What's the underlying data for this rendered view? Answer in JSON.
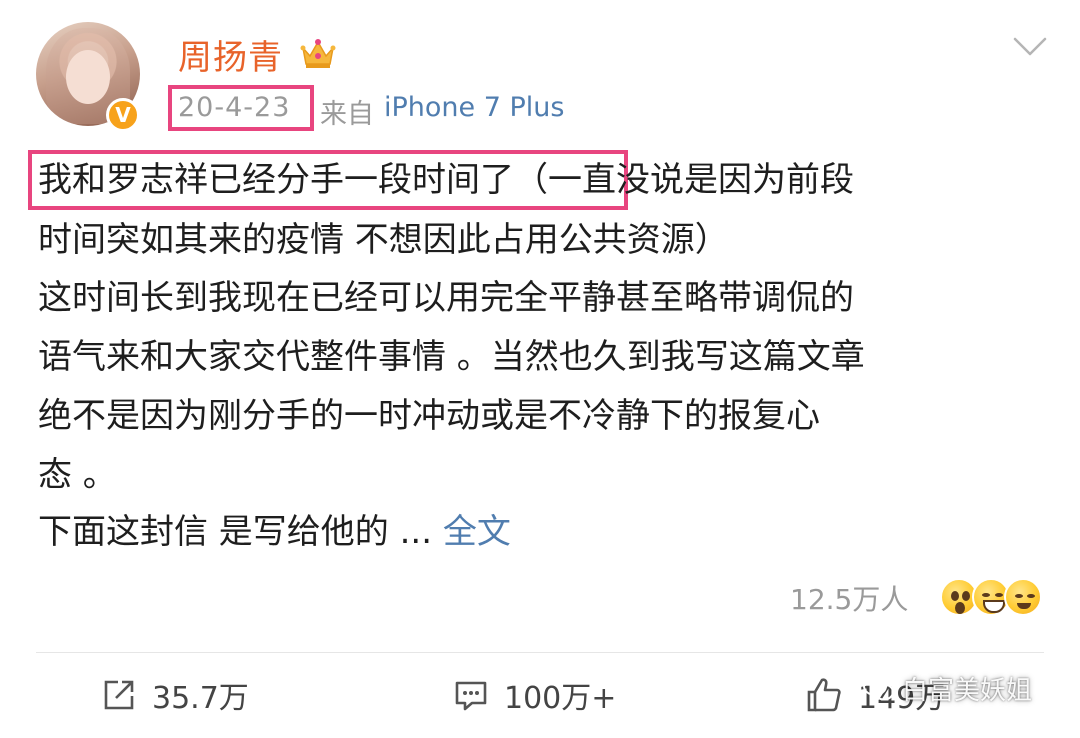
{
  "header": {
    "username": "周扬青",
    "verified_badge": "V",
    "date": "20-4-23",
    "source_prefix": "来自",
    "device": "iPhone 7 Plus",
    "menu_icon": "chevron-down-icon",
    "crown_icon": "crown-icon"
  },
  "post": {
    "lines": [
      "我和罗志祥已经分手一段时间了（一直没说是因为前段",
      "时间突如其来的疫情 不想因此占用公共资源）",
      "这时间长到我现在已经可以用完全平静甚至略带调侃的",
      "语气来和大家交代整件事情 。当然也久到我写这篇文章",
      "绝不是因为刚分手的一时冲动或是不冷静下的报复心",
      "态 。"
    ],
    "last_line_prefix": "下面这封信 是写给他的 ... ",
    "full_text_link": "全文"
  },
  "stats": {
    "views": "12.5万人",
    "reaction_icons": [
      "shocked-face-icon",
      "laughing-face-icon",
      "grinning-face-icon"
    ]
  },
  "actions": {
    "repost_count": "35.7万",
    "comment_count": "100万+",
    "like_count": "149万"
  },
  "watermark": {
    "text": "白富美妖姐",
    "icon": "wechat-icon"
  },
  "colors": {
    "username": "#e8632a",
    "link": "#507daf",
    "highlight_border": "#e8457f",
    "muted_text": "#9a9a9a"
  }
}
